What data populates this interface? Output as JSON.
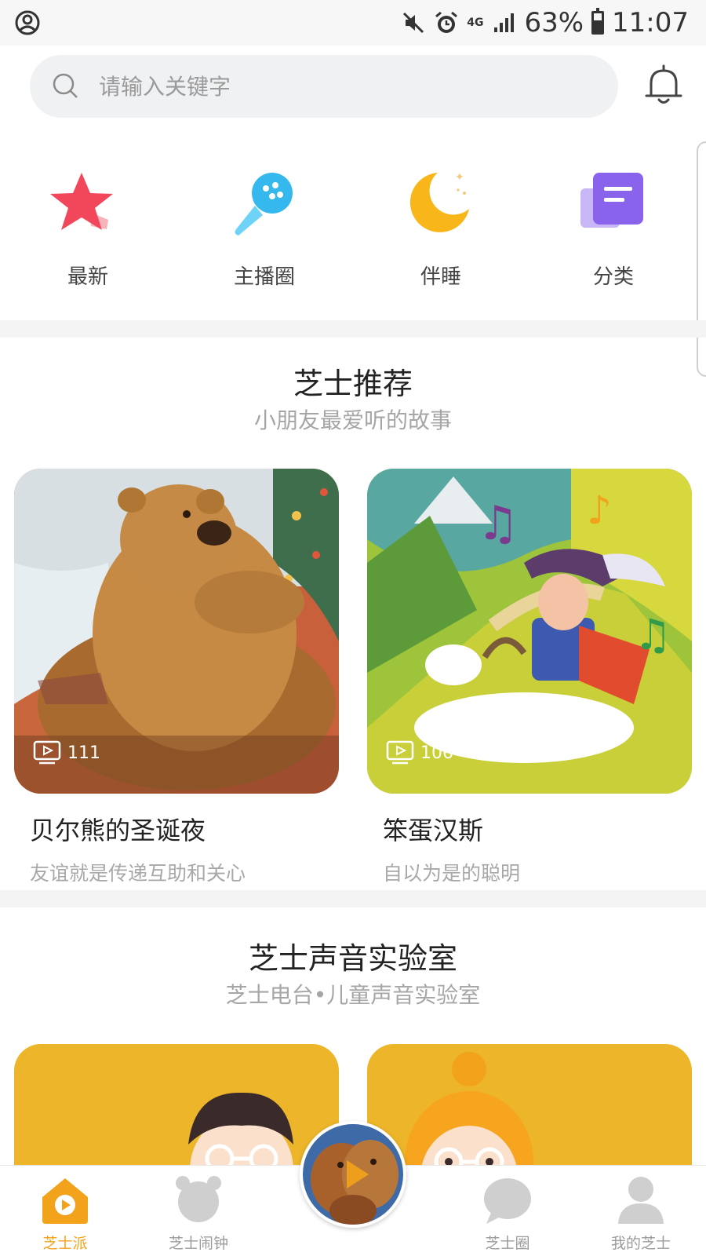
{
  "status_bar": {
    "network": "4G",
    "battery": "63%",
    "battery_level": 0.63,
    "time": "11:07"
  },
  "search": {
    "placeholder": "请输入关键字"
  },
  "categories": [
    {
      "label": "最新",
      "icon": "star-icon"
    },
    {
      "label": "主播圈",
      "icon": "microphone-icon"
    },
    {
      "label": "伴睡",
      "icon": "moon-icon"
    },
    {
      "label": "分类",
      "icon": "document-icon"
    }
  ],
  "recommend": {
    "title": "芝士推荐",
    "subtitle": "小朋友最爱听的故事",
    "items": [
      {
        "title": "贝尔熊的圣诞夜",
        "subtitle": "友谊就是传递互助和关心",
        "plays": "111"
      },
      {
        "title": "笨蛋汉斯",
        "subtitle": "自以为是的聪明",
        "plays": "106"
      }
    ]
  },
  "lab": {
    "title": "芝士声音实验室",
    "subtitle": "芝士电台•儿童声音实验室"
  },
  "tabs": [
    {
      "label": "芝士派",
      "icon": "home-play-icon",
      "active": true
    },
    {
      "label": "芝士闹钟",
      "icon": "alarm-clock-icon",
      "active": false
    },
    {
      "label": "芝士圈",
      "icon": "chat-bubble-icon",
      "active": false
    },
    {
      "label": "我的芝士",
      "icon": "user-icon",
      "active": false
    }
  ],
  "colors": {
    "accent": "#f3a21b",
    "lab_card": "#ecb52a",
    "search_bg": "#f0f1f3"
  }
}
